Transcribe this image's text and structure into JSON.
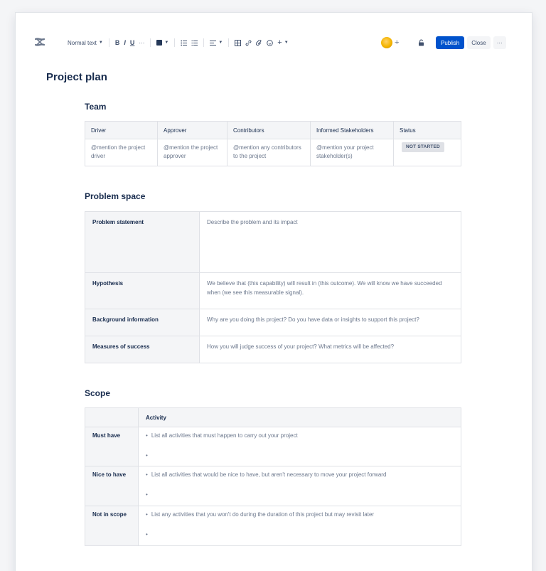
{
  "toolbar": {
    "text_style": "Normal text",
    "bold": "B",
    "italic": "I",
    "underline": "U",
    "more": "···",
    "insert_plus": "+",
    "publish_label": "Publish",
    "close_label": "Close",
    "overflow_label": "···",
    "invite_plus": "+"
  },
  "page": {
    "title": "Project plan"
  },
  "team": {
    "heading": "Team",
    "headers": [
      "Driver",
      "Approver",
      "Contributors",
      "Informed Stakeholders",
      "Status"
    ],
    "row": [
      "@mention the project driver",
      "@mention the project approver",
      "@mention any contributors to the project",
      "@mention your project stakeholder(s)"
    ],
    "status": "NOT STARTED"
  },
  "problem_space": {
    "heading": "Problem space",
    "rows": [
      {
        "label": "Problem statement",
        "value": "Describe the problem and its impact"
      },
      {
        "label": "Hypothesis",
        "value": "We believe that (this capability) will result in (this outcome). We will know we have succeeded when (we see this measurable signal)."
      },
      {
        "label": "Background information",
        "value": "Why are you doing this project? Do you have data or insights to support this project?"
      },
      {
        "label": "Measures of success",
        "value": "How you will judge success of your project? What metrics will be affected?"
      }
    ]
  },
  "scope": {
    "heading": "Scope",
    "header": "Activity",
    "rows": [
      {
        "label": "Must have",
        "item": "List all activities that must happen to carry out your project"
      },
      {
        "label": "Nice to have",
        "item": "List all activities that would be nice to have, but aren't necessary to move your project forward"
      },
      {
        "label": "Not in scope",
        "item": "List any activities that you won't do during the duration of this project but may revisit later"
      }
    ]
  },
  "colors": {
    "publish": "#0052cc",
    "header_bg": "#f4f5f7",
    "border": "#dfe1e6",
    "text": "#172b4d",
    "muted": "#6b778c"
  },
  "icons": [
    "confluence-logo-icon",
    "bullet-list-icon",
    "numbered-list-icon",
    "align-icon",
    "table-icon",
    "link-icon",
    "attachment-icon",
    "emoji-icon",
    "lock-icon"
  ]
}
